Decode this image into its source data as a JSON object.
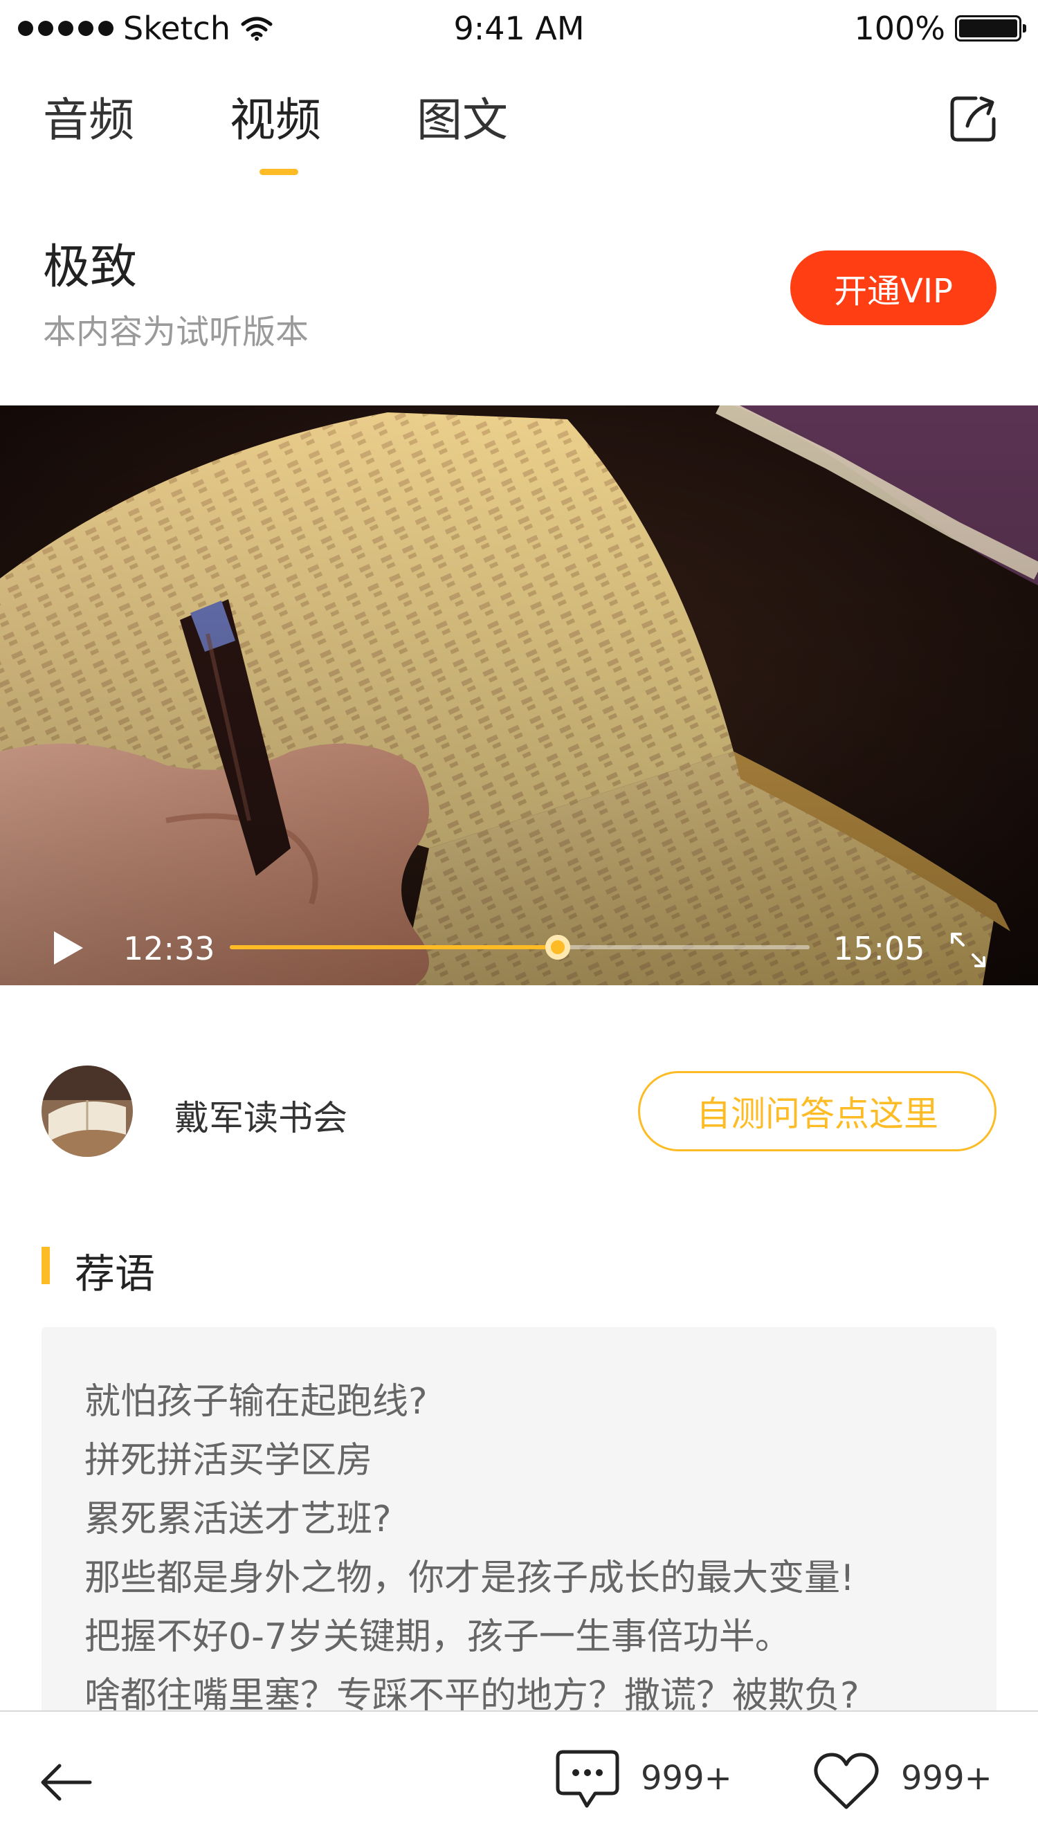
{
  "status_bar": {
    "carrier": "Sketch",
    "time": "9:41 AM",
    "battery": "100%"
  },
  "tabs": [
    {
      "label": "音频",
      "active": false
    },
    {
      "label": "视频",
      "active": true
    },
    {
      "label": "图文",
      "active": false
    }
  ],
  "header": {
    "title": "极致",
    "subtitle": "本内容为试听版本",
    "vip_button": "开通VIP"
  },
  "video": {
    "current_time": "12:33",
    "total_time": "15:05",
    "progress": 0.566
  },
  "author": {
    "name": "戴军读书会",
    "quiz_button": "自测问答点这里"
  },
  "recommendation": {
    "title": "荐语",
    "lines": [
      "就怕孩子输在起跑线?",
      "拼死拼活买学区房",
      "累死累活送才艺班?",
      "那些都是身外之物，你才是孩子成长的最大变量!",
      "把握不好0-7岁关键期，孩子一生事倍功半。",
      "啥都往嘴里塞？专踩不平的地方？撒谎？被欺负?"
    ]
  },
  "bottom_bar": {
    "comment_count": "999+",
    "like_count": "999+"
  },
  "colors": {
    "accent": "#FDBC25",
    "vip": "#FF3E14"
  }
}
